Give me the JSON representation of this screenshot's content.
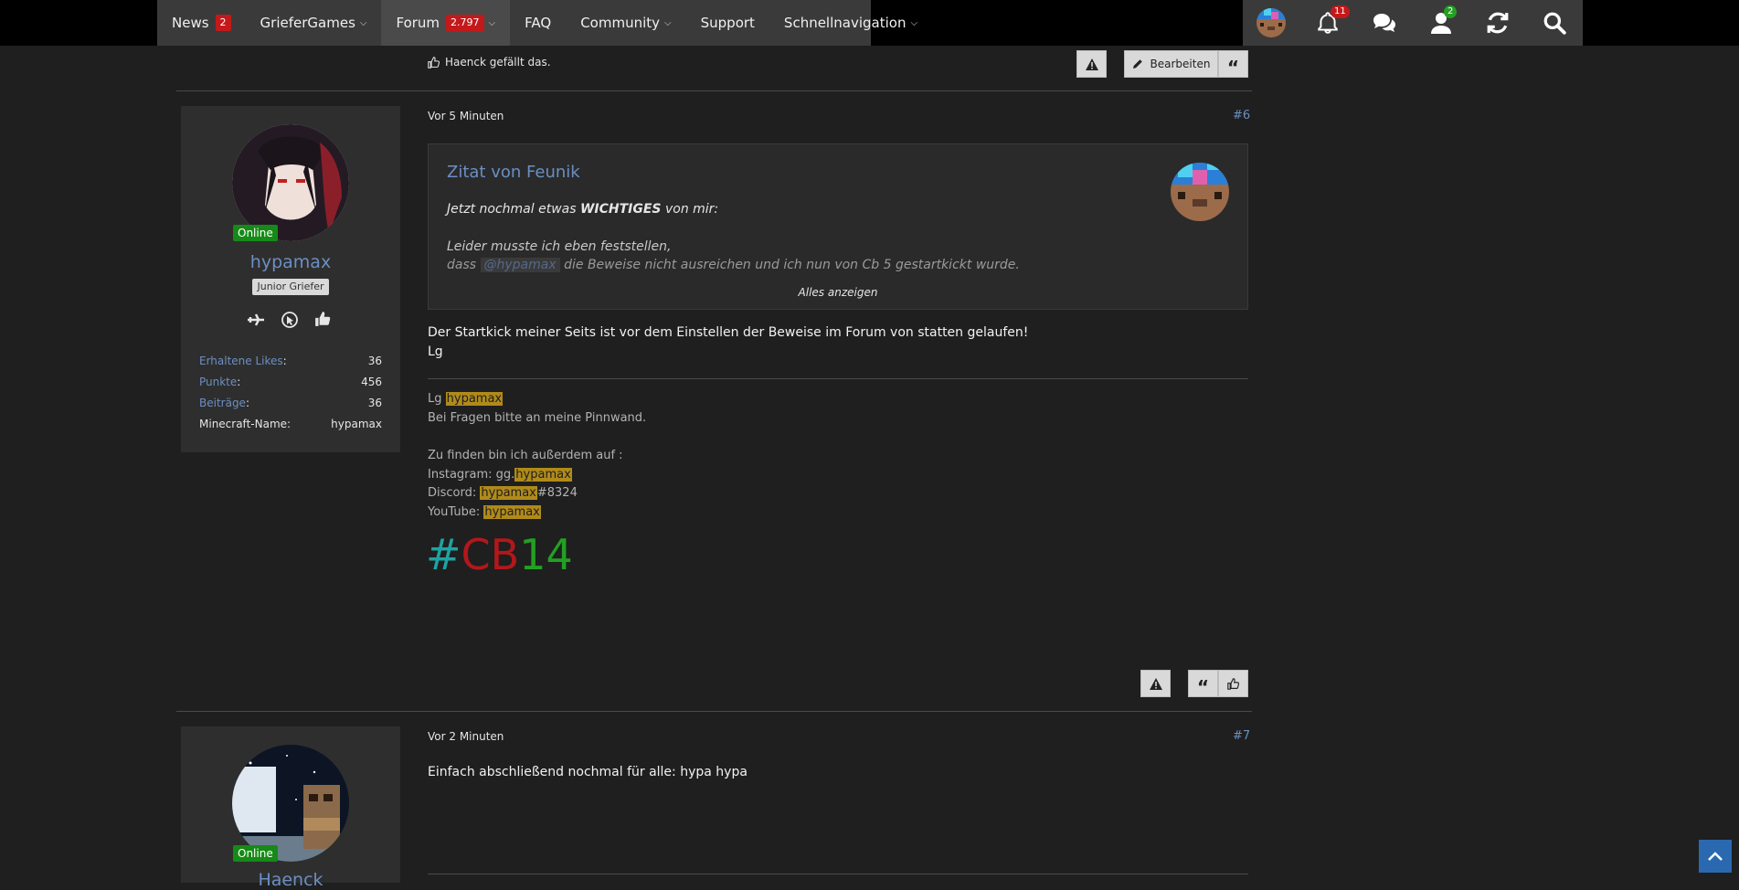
{
  "nav": {
    "items": [
      {
        "label": "News",
        "badge": "2"
      },
      {
        "label": "GrieferGames"
      },
      {
        "label": "Forum",
        "badge": "2.797"
      },
      {
        "label": "FAQ"
      },
      {
        "label": "Community"
      },
      {
        "label": "Support"
      },
      {
        "label": "Schnellnavigation"
      }
    ],
    "notifications_badge": "11",
    "friends_badge": "2"
  },
  "prev_post": {
    "like_text": "Haenck gefällt das.",
    "edit_label": "Bearbeiten"
  },
  "post6": {
    "time": "Vor 5 Minuten",
    "number": "#6",
    "author": {
      "status": "Online",
      "name": "hypamax",
      "rank": "Junior Griefer",
      "stats": [
        {
          "k": "Erhaltene Likes",
          "v": "36"
        },
        {
          "k": "Punkte",
          "v": "456"
        },
        {
          "k": "Beiträge",
          "v": "36"
        },
        {
          "k": "Minecraft-Name",
          "v": "hypamax"
        }
      ]
    },
    "quote": {
      "title": "Zitat von Feunik",
      "line1_pre": "Jetzt nochmal etwas ",
      "line1_bold": "WICHTIGES",
      "line1_post": " von mir:",
      "line2": "Leider musste ich eben feststellen,",
      "line3_pre": "dass ",
      "line3_mention": "@hypamax",
      "line3_post": " die Beweise nicht ausreichen und ich nun von Cb 5 gestartkickt wurde.",
      "show_all": "Alles anzeigen"
    },
    "body": [
      "Der Startkick meiner Seits ist vor dem Einstellen der Beweise im Forum von statten gelaufen!",
      "Lg"
    ],
    "signature": {
      "l1_pre": "Lg ",
      "l1_hl": "hypamax",
      "l2": "Bei Fragen bitte an meine Pinnwand.",
      "l3": "Zu finden bin ich außerdem auf :",
      "l4_pre": "Instagram: gg.",
      "l4_hl": "hypamax",
      "l5_pre": "Discord: ",
      "l5_hl": "hypamax",
      "l5_post": "#8324",
      "l6_pre": "YouTube: ",
      "l6_hl": "hypamax",
      "cb_hash": "#",
      "cb_letters": "CB",
      "cb_num": "14"
    }
  },
  "post7": {
    "time": "Vor 2 Minuten",
    "number": "#7",
    "author": {
      "status": "Online",
      "name": "Haenck"
    },
    "body": "Einfach abschließend nochmal für alle: hypa hypa"
  },
  "colors": {
    "accent": "#6b8fc3",
    "badge_red": "#c3191b",
    "online_green": "#168a16",
    "highlight": "#b08a1a",
    "cb_hash": "#1ea3a3",
    "cb_letters": "#b3171b",
    "cb_num": "#22a022"
  }
}
